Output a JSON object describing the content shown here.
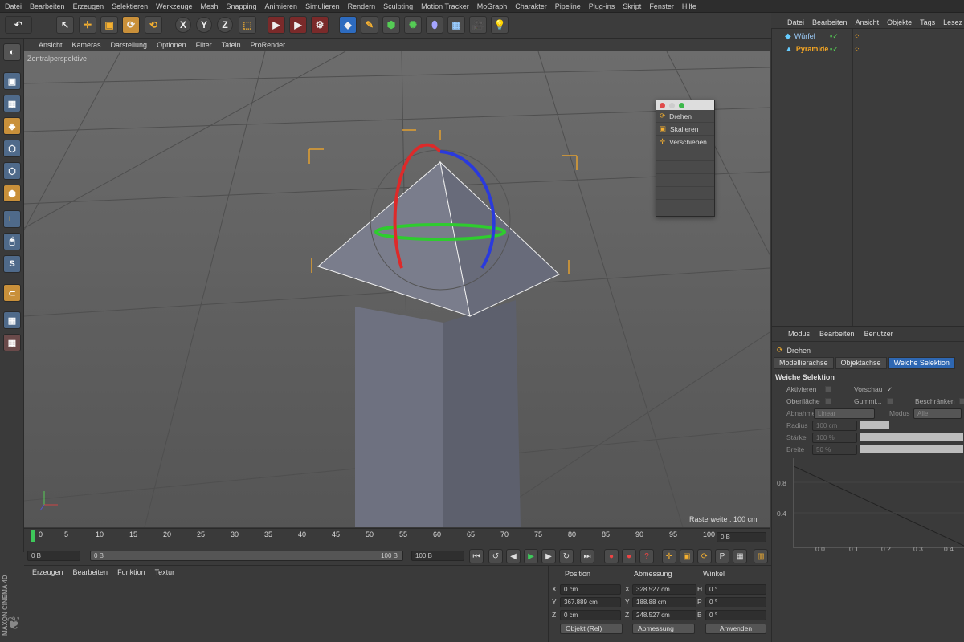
{
  "menubar": [
    "Datei",
    "Bearbeiten",
    "Erzeugen",
    "Selektieren",
    "Werkzeuge",
    "Mesh",
    "Snapping",
    "Animieren",
    "Simulieren",
    "Rendern",
    "Sculpting",
    "Motion Tracker",
    "MoGraph",
    "Charakter",
    "Pipeline",
    "Plug-ins",
    "Skript",
    "Fenster",
    "Hilfe"
  ],
  "toolbar": {
    "axis_x": "X",
    "axis_y": "Y",
    "axis_z": "Z"
  },
  "viewport": {
    "menu": [
      "Ansicht",
      "Kameras",
      "Darstellung",
      "Optionen",
      "Filter",
      "Tafeln",
      "ProRender"
    ],
    "label": "Zentralperspektive",
    "raster": "Rasterweite : 100 cm"
  },
  "popup": {
    "items": [
      "Drehen",
      "Skalieren",
      "Verschieben"
    ]
  },
  "timeline": {
    "ticks": [
      "0",
      "5",
      "10",
      "15",
      "20",
      "25",
      "30",
      "35",
      "40",
      "45",
      "50",
      "55",
      "60",
      "65",
      "70",
      "75",
      "80",
      "85",
      "90",
      "95",
      "100"
    ],
    "frame_display": "0 B",
    "start": "0 B",
    "range_start": "0 B",
    "range_end": "100 B",
    "end": "100 B"
  },
  "material_menu": [
    "Erzeugen",
    "Bearbeiten",
    "Funktion",
    "Textur"
  ],
  "coords": {
    "headers": {
      "position": "Position",
      "size": "Abmessung",
      "rotation": "Winkel"
    },
    "x_label": "X",
    "y_label": "Y",
    "z_label": "Z",
    "h_label": "H",
    "p_label": "P",
    "b_label": "B",
    "pos_x": "0 cm",
    "pos_y": "367.889 cm",
    "pos_z": "0 cm",
    "size_x": "328.527 cm",
    "size_y": "188.88 cm",
    "size_z": "248.527 cm",
    "rot_h": "0 °",
    "rot_p": "0 °",
    "rot_b": "0 °",
    "mode": "Objekt (Rel)",
    "size_mode": "Abmessung",
    "apply": "Anwenden"
  },
  "objects_menu": [
    "Datei",
    "Bearbeiten",
    "Ansicht",
    "Objekte",
    "Tags",
    "Lesez"
  ],
  "objects": [
    {
      "name": "Würfel",
      "color": "#9fd0ff"
    },
    {
      "name": "Pyramide",
      "color": "#f5a623"
    }
  ],
  "attributes": {
    "menu": [
      "Modus",
      "Bearbeiten",
      "Benutzer"
    ],
    "tool": "Drehen",
    "tabs": [
      "Modellierachse",
      "Objektachse",
      "Weiche Selektion"
    ],
    "section": "Weiche Selektion",
    "aktivieren": "Aktivieren",
    "vorschau": "Vorschau",
    "oberflaeche": "Oberfläche",
    "gummi": "Gummi...",
    "beschraenken": "Beschränken",
    "abnahme": "Abnahme",
    "abnahme_val": "Linear",
    "modus": "Modus",
    "modus_val": "Alle",
    "radius": "Radius",
    "radius_val": "100 cm",
    "staerke": "Stärke",
    "staerke_val": "100 %",
    "breite": "Breite",
    "breite_val": "50 %",
    "graph_y1": "0.8",
    "graph_y2": "0.4",
    "graph_x": [
      "0.0",
      "0.1",
      "0.2",
      "0.3",
      "0.4"
    ]
  },
  "brand": "MAXON CINEMA 4D"
}
